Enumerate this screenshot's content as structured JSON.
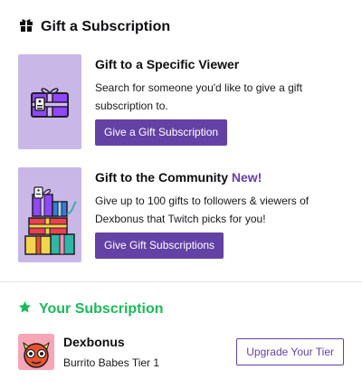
{
  "header": {
    "title": "Gift a Subscription",
    "icon": "gift-icon"
  },
  "gift_specific": {
    "title": "Gift to a Specific Viewer",
    "description": "Search for someone you'd like to give a gift subscription to.",
    "button_label": "Give a Gift Subscription",
    "icon": "gift-box-illustration"
  },
  "gift_community": {
    "title": "Gift to the Community",
    "badge": "New!",
    "description": "Give up to 100 gifts to followers & viewers of Dexbonus that Twitch picks for you!",
    "button_label": "Give Gift Subscriptions",
    "icon": "gift-pile-illustration"
  },
  "your_subscription": {
    "title": "Your Subscription",
    "icon": "star-icon",
    "channel_name": "Dexbonus",
    "tier": "Burrito Babes Tier 1",
    "upgrade_label": "Upgrade Your Tier"
  },
  "colors": {
    "accent_purple": "#6441a5",
    "thumb_bg": "#c9b7e8",
    "success_green": "#1cb95a"
  }
}
